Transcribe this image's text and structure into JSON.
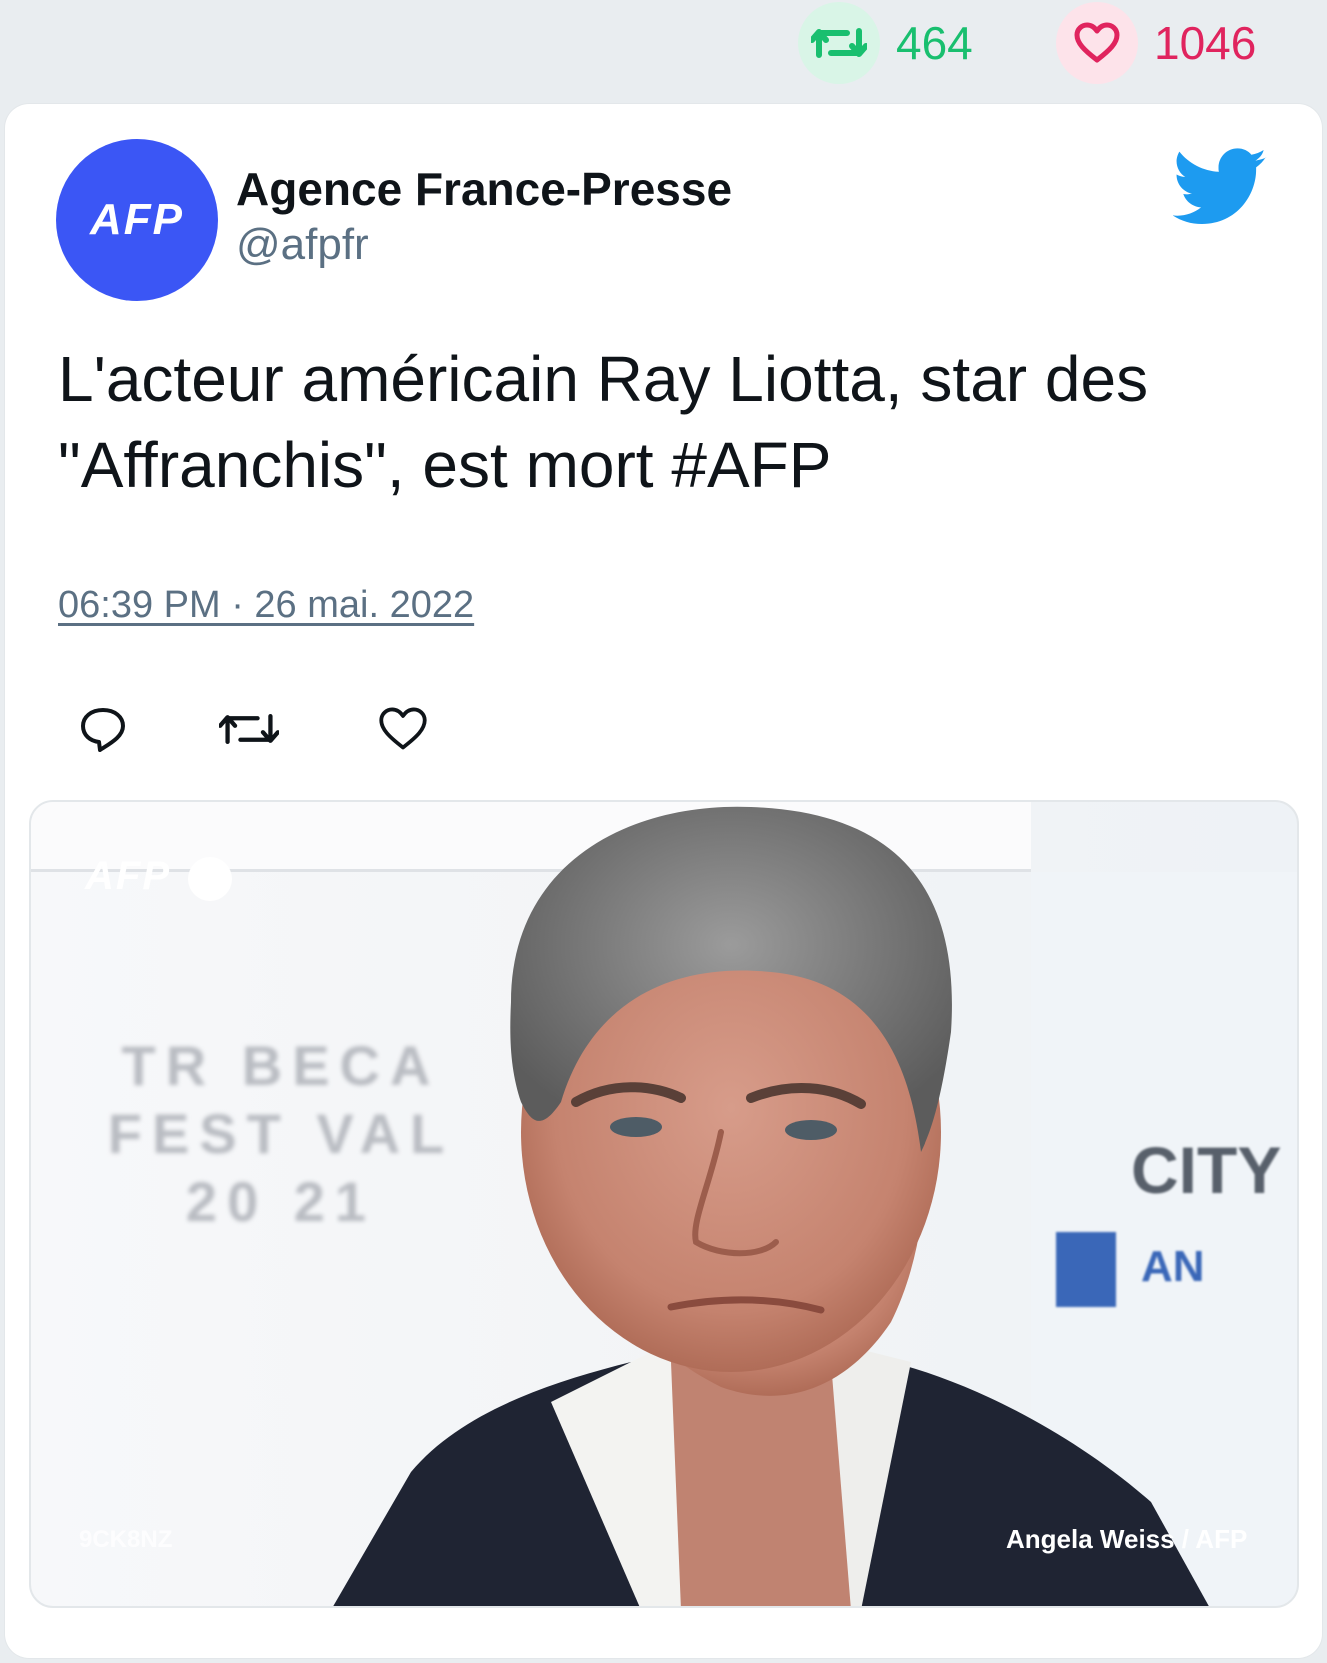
{
  "stats": {
    "retweet_count": "464",
    "like_count": "1046",
    "retweet_icon": "retweet-icon",
    "like_icon": "heart-icon"
  },
  "tweet": {
    "avatar_label": "AFP",
    "display_name": "Agence France-Presse",
    "handle": "@afpfr",
    "text": "L'acteur américain Ray Liotta, star des \"Affranchis\", est mort #AFP",
    "timestamp": "06:39 PM · 26 mai. 2022",
    "platform_icon": "twitter-bird-icon"
  },
  "actions": {
    "reply_icon": "reply-icon",
    "retweet_icon": "retweet-icon",
    "like_icon": "like-icon"
  },
  "media": {
    "watermark": "AFP",
    "backdrop_text": "TR BECA FEST VAL 20 21",
    "sponsor_text": "CITY",
    "sponsor_sub": "AN",
    "photo_code": "9CK8NZ",
    "credit": "Angela Weiss / AFP"
  },
  "colors": {
    "retweet_green": "#19bf6f",
    "like_pink": "#e0245e",
    "twitter_blue": "#1d9bf0",
    "afp_blue": "#3b56f5"
  }
}
